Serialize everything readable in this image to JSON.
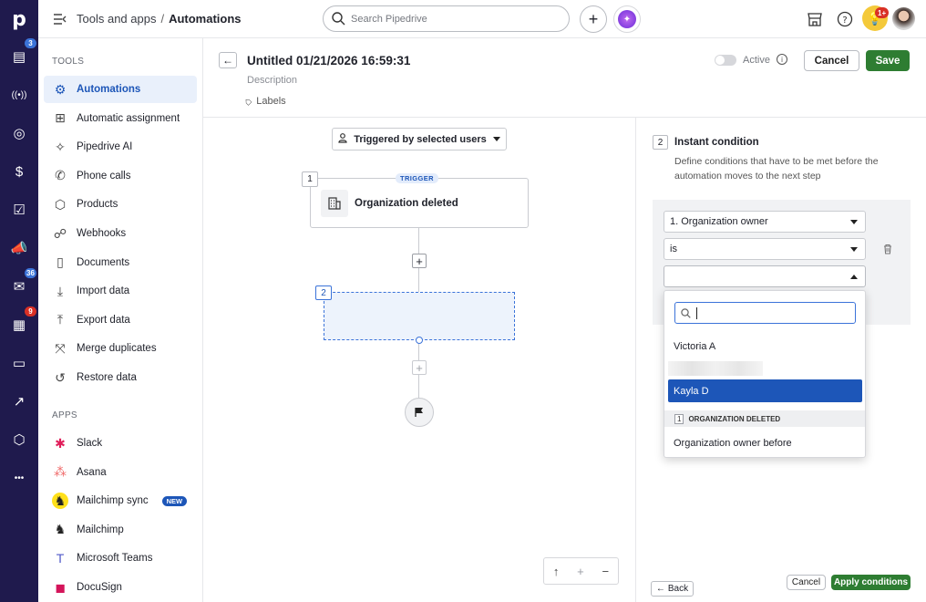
{
  "rail": {
    "logo": "p",
    "items": [
      {
        "icon": "deals-icon",
        "badge": "3"
      },
      {
        "icon": "leads-icon",
        "badge": ""
      },
      {
        "icon": "projects-icon",
        "badge": ""
      },
      {
        "icon": "money-icon",
        "badge": ""
      },
      {
        "icon": "activities-icon",
        "badge": ""
      },
      {
        "icon": "campaigns-icon",
        "badge": ""
      },
      {
        "icon": "mail-icon",
        "badge": "36"
      },
      {
        "icon": "calendar-icon",
        "badge": "9"
      },
      {
        "icon": "contacts-icon",
        "badge": ""
      },
      {
        "icon": "insights-icon",
        "badge": ""
      },
      {
        "icon": "products-icon",
        "badge": ""
      },
      {
        "icon": "more-icon",
        "badge": ""
      }
    ]
  },
  "topbar": {
    "breadcrumb_parent": "Tools and apps",
    "breadcrumb_sep": "/",
    "breadcrumb_current": "Automations",
    "search_placeholder": "Search Pipedrive",
    "notif_badge": "1+"
  },
  "sidebar": {
    "tools_label": "TOOLS",
    "tools": [
      {
        "label": "Automations",
        "icon": "automations-icon",
        "active": true
      },
      {
        "label": "Automatic assignment",
        "icon": "assignment-icon"
      },
      {
        "label": "Pipedrive AI",
        "icon": "ai-sparkle-icon"
      },
      {
        "label": "Phone calls",
        "icon": "phone-icon"
      },
      {
        "label": "Products",
        "icon": "product-box-icon"
      },
      {
        "label": "Webhooks",
        "icon": "webhook-icon"
      },
      {
        "label": "Documents",
        "icon": "document-icon"
      },
      {
        "label": "Import data",
        "icon": "import-icon"
      },
      {
        "label": "Export data",
        "icon": "export-icon"
      },
      {
        "label": "Merge duplicates",
        "icon": "merge-icon"
      },
      {
        "label": "Restore data",
        "icon": "restore-icon"
      }
    ],
    "apps_label": "APPS",
    "apps": [
      {
        "label": "Slack",
        "icon": "slack-icon"
      },
      {
        "label": "Asana",
        "icon": "asana-icon"
      },
      {
        "label": "Mailchimp sync",
        "icon": "mailchimp-icon",
        "badge": "NEW"
      },
      {
        "label": "Mailchimp",
        "icon": "mailchimp-icon"
      },
      {
        "label": "Microsoft Teams",
        "icon": "teams-icon"
      },
      {
        "label": "DocuSign",
        "icon": "docusign-icon"
      }
    ]
  },
  "header": {
    "title": "Untitled 01/21/2026 16:59:31",
    "description_placeholder": "Description",
    "labels": "Labels",
    "active_label": "Active",
    "cancel": "Cancel",
    "save": "Save"
  },
  "canvas": {
    "trigger_select": "Triggered by selected users",
    "step1_number": "1",
    "trigger_tag": "TRIGGER",
    "step1_label": "Organization deleted",
    "step2_number": "2"
  },
  "panel": {
    "step_number": "2",
    "title": "Instant condition",
    "description": "Define conditions that have to be met before the automation moves to the next step",
    "field_value": "1. Organization owner",
    "operator_value": "is",
    "value_value": "",
    "dropdown": {
      "search_value": "",
      "options": [
        "Victoria A",
        "",
        "Kayla D"
      ],
      "selected_index": 2,
      "group_number": "1",
      "group_label": "ORGANIZATION DELETED",
      "group_options": [
        "Organization owner before"
      ]
    },
    "back": "Back",
    "cancel": "Cancel",
    "apply": "Apply conditions"
  },
  "colors": {
    "rail_bg": "#1f1a4d",
    "accent_blue": "#1d56b8",
    "save_green": "#2e7d32",
    "badge_blue": "#3b73d9",
    "badge_red": "#d93025"
  }
}
